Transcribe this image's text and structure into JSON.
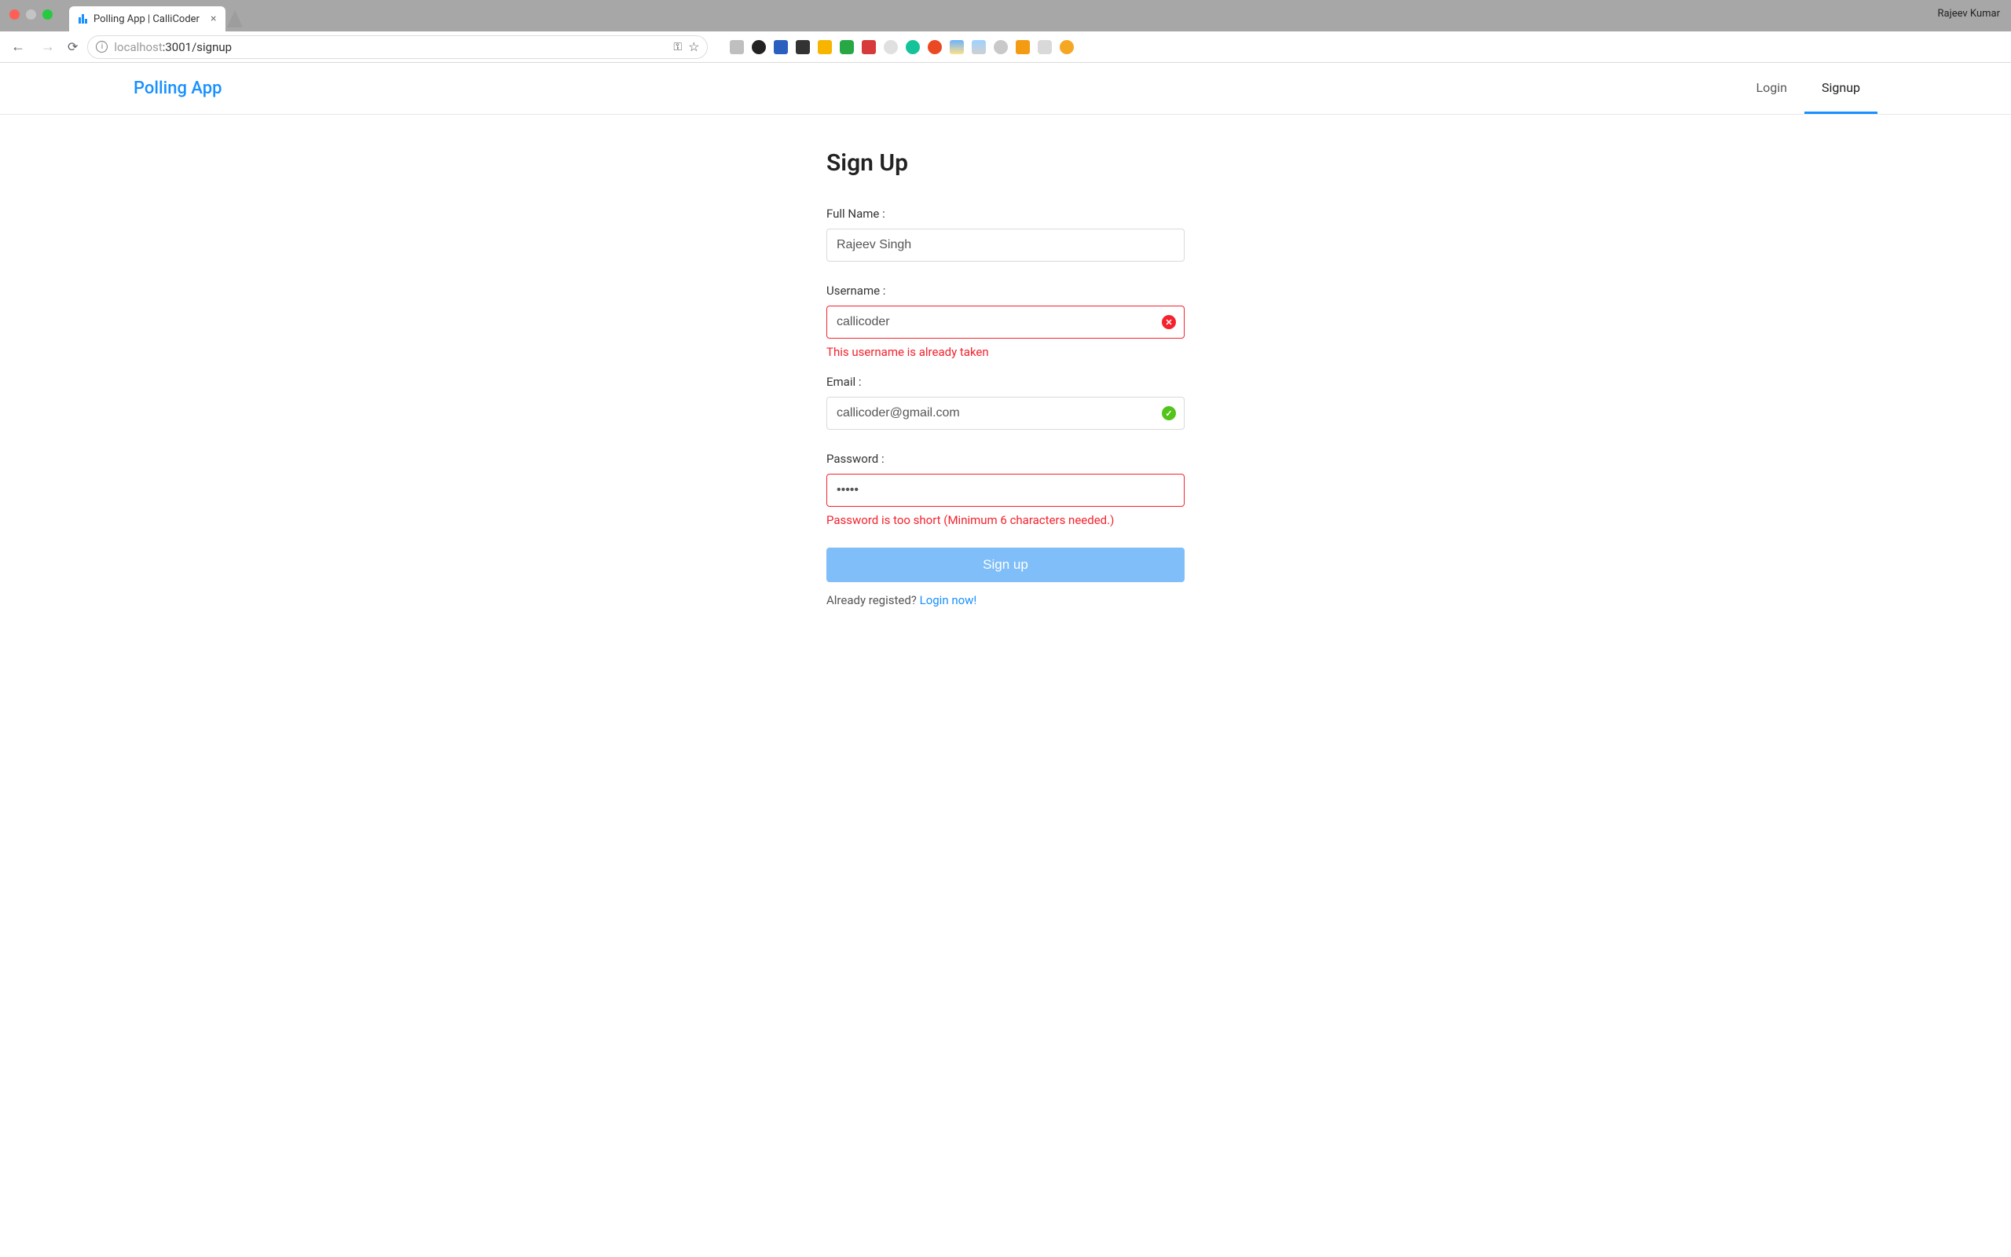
{
  "chrome": {
    "tab_title": "Polling App | CalliCoder",
    "profile_name": "Rajeev Kumar",
    "url_muted": "localhost",
    "url_rest": ":3001/signup"
  },
  "header": {
    "brand": "Polling App",
    "nav_login": "Login",
    "nav_signup": "Signup"
  },
  "form": {
    "title": "Sign Up",
    "fullname_label": "Full Name :",
    "fullname_value": "Rajeev Singh",
    "username_label": "Username :",
    "username_value": "callicoder",
    "username_error": "This username is already taken",
    "email_label": "Email :",
    "email_value": "callicoder@gmail.com",
    "password_label": "Password :",
    "password_value": "•••••",
    "password_error": "Password is too short (Minimum 6 characters needed.)",
    "submit_label": "Sign up",
    "hint_text": "Already registed? ",
    "hint_link": "Login now!"
  },
  "colors": {
    "primary": "#1890ff",
    "error": "#f5222d",
    "success": "#52c41a"
  }
}
